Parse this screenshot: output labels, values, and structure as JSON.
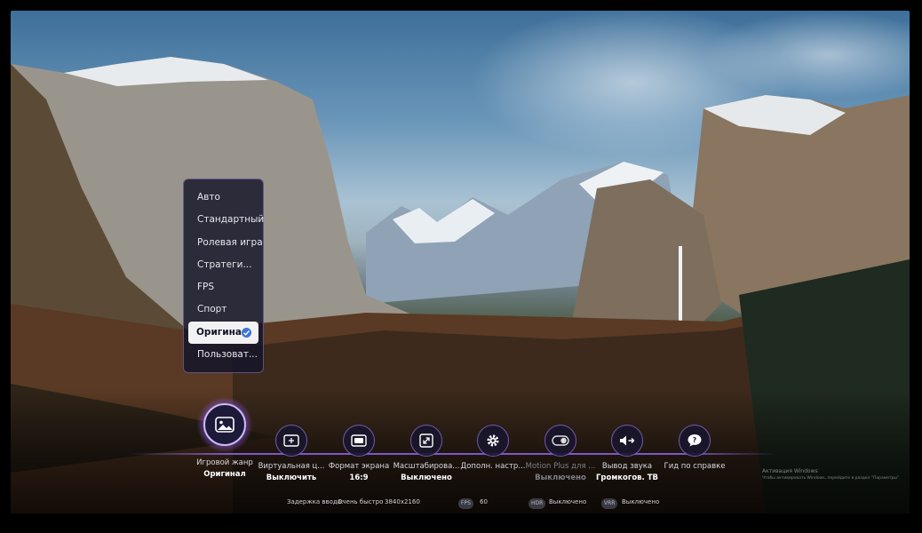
{
  "genre_menu": {
    "items": [
      "Авто",
      "Стандартный",
      "Ролевая игра",
      "Стратеги...",
      "FPS",
      "Спорт",
      "Оригинал",
      "Пользоват..."
    ],
    "selected_index": 6
  },
  "bottom_bar": {
    "items": [
      {
        "label": "Игровой жанр",
        "value": "Оригинал",
        "icon": "image-icon",
        "active": true
      },
      {
        "label": "Виртуальная ц...",
        "value": "Выключить",
        "icon": "crosshair-screen-icon"
      },
      {
        "label": "Формат экрана",
        "value": "16:9",
        "icon": "aspect-ratio-icon"
      },
      {
        "label": "Масштабирова...",
        "value": "Выключено",
        "icon": "zoom-expand-icon"
      },
      {
        "label": "Дополн. настр...",
        "value": "",
        "icon": "gear-icon"
      },
      {
        "label": "Motion Plus для ...",
        "value": "Выключено",
        "icon": "toggle-icon",
        "disabled": true
      },
      {
        "label": "Вывод звука",
        "value": "Громкогов. ТВ",
        "icon": "speaker-output-icon"
      },
      {
        "label": "Гид по справке",
        "value": "",
        "icon": "help-bubble-icon"
      }
    ]
  },
  "status_bar": {
    "input_lag_label": "Задержка ввода:",
    "input_lag_value": "Очень быстро",
    "resolution": "3840x2160",
    "fps_badge": "FPS",
    "fps_value": "60",
    "hdr_badge": "HDR",
    "hdr_value": "Выключено",
    "vrr_badge": "VRR",
    "vrr_value": "Выключено"
  },
  "watermark": {
    "line1": "Активация Windows",
    "line2": "Чтобы активировать Windows, перейдите в раздел \"Параметры\"."
  },
  "colors": {
    "accent": "#8c64e6",
    "check": "#3b74d6",
    "menu_bg": "#12142a"
  }
}
